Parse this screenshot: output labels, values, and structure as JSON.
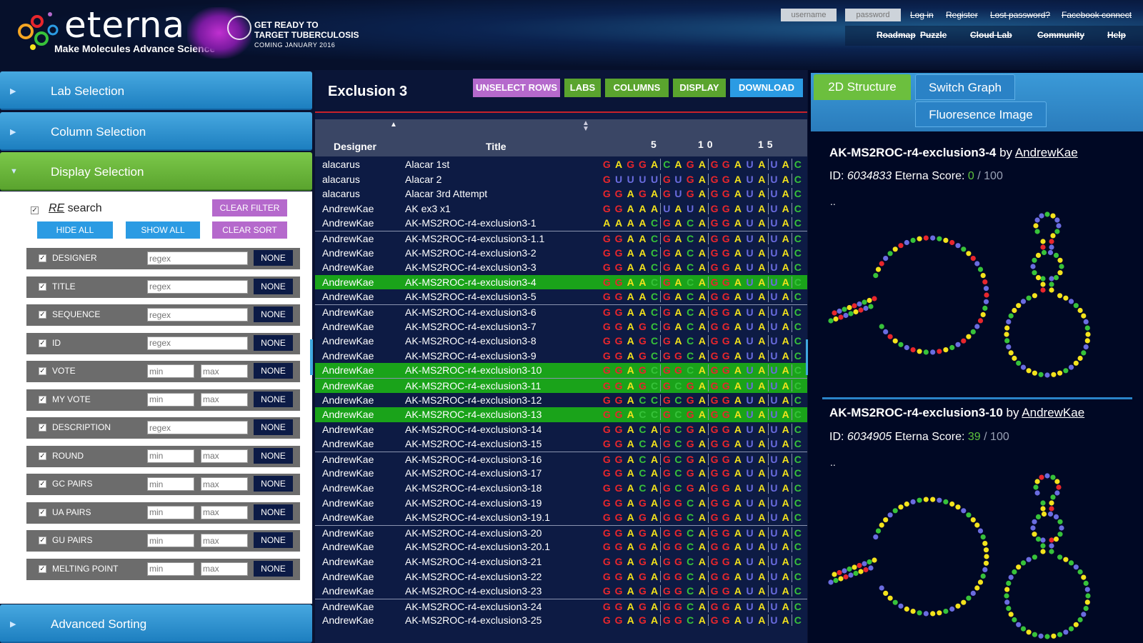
{
  "header": {
    "brand": "eterna",
    "tagline": "Make Molecules  Advance Science",
    "promo_line1": "GET READY TO",
    "promo_line2": "TARGET TUBERCULOSIS",
    "promo_line3": "COMING JANUARY 2016",
    "username_placeholder": "username",
    "password_placeholder": "password",
    "links": [
      "Log in",
      "Register",
      "Lost password?",
      "Facebook connect"
    ],
    "nav": [
      "Roadmap",
      "Puzzle",
      "Cloud Lab",
      "Community",
      "Help"
    ]
  },
  "sidebar": {
    "lab_selection": "Lab Selection",
    "column_selection": "Column Selection",
    "display_selection": "Display Selection",
    "advanced_sorting": "Advanced Sorting",
    "re_prefix": "RE",
    "re_search": " search",
    "clear_filter": "CLEAR FILTER",
    "hide_all": "HIDE ALL",
    "show_all": "SHOW ALL",
    "clear_sort": "CLEAR SORT",
    "none_label": "NONE",
    "filters": [
      {
        "name": "DESIGNER",
        "kind": "regex",
        "p1": "regex"
      },
      {
        "name": "TITLE",
        "kind": "regex",
        "p1": "regex"
      },
      {
        "name": "SEQUENCE",
        "kind": "regex",
        "p1": "regex"
      },
      {
        "name": "ID",
        "kind": "regex",
        "p1": "regex"
      },
      {
        "name": "VOTE",
        "kind": "range",
        "p1": "min",
        "p2": "max"
      },
      {
        "name": "MY VOTE",
        "kind": "range",
        "p1": "min",
        "p2": "max"
      },
      {
        "name": "DESCRIPTION",
        "kind": "regex",
        "p1": "regex"
      },
      {
        "name": "ROUND",
        "kind": "range",
        "p1": "min",
        "p2": "max"
      },
      {
        "name": "GC PAIRS",
        "kind": "range",
        "p1": "min",
        "p2": "max"
      },
      {
        "name": "UA PAIRS",
        "kind": "range",
        "p1": "min",
        "p2": "max"
      },
      {
        "name": "GU PAIRS",
        "kind": "range",
        "p1": "min",
        "p2": "max"
      },
      {
        "name": "MELTING POINT",
        "kind": "range",
        "p1": "min",
        "p2": "max"
      }
    ]
  },
  "table": {
    "title": "Exclusion 3",
    "buttons": [
      "UNSELECT ROWS",
      "LABS",
      "COLUMNS",
      "DISPLAY",
      "DOWNLOAD"
    ],
    "col_designer": "Designer",
    "col_title": "Title",
    "seq_ticks": [
      "5",
      "10",
      "15"
    ],
    "rows": [
      {
        "designer": "alacarus",
        "title": "Alacar 1st",
        "seq": "GAGGACAGAGGAUAUAC",
        "sel": false,
        "grp": true
      },
      {
        "designer": "alacarus",
        "title": "Alacar 2",
        "seq": "GUUUUGUGAGGAUAUAC",
        "sel": false,
        "grp": false
      },
      {
        "designer": "alacarus",
        "title": "Alacar 3rd Attempt",
        "seq": "GGAGAGUGAGGAUAUAC",
        "sel": false,
        "grp": false
      },
      {
        "designer": "AndrewKae",
        "title": "AK ex3 x1",
        "seq": "GGAAAUAUAGGAUAUAC",
        "sel": false,
        "grp": false
      },
      {
        "designer": "AndrewKae",
        "title": "AK-MS2ROC-r4-exclusion3-1",
        "seq": "AAAACGACAGGAUAUAC",
        "sel": false,
        "grp": false
      },
      {
        "designer": "AndrewKae",
        "title": "AK-MS2ROC-r4-exclusion3-1.1",
        "seq": "GGAACGACAGGAUAUAC",
        "sel": false,
        "grp": true
      },
      {
        "designer": "AndrewKae",
        "title": "AK-MS2ROC-r4-exclusion3-2",
        "seq": "GGAACGACAGGAUAUAC",
        "sel": false,
        "grp": false
      },
      {
        "designer": "AndrewKae",
        "title": "AK-MS2ROC-r4-exclusion3-3",
        "seq": "GGAACGACAGGAUAUAC",
        "sel": false,
        "grp": false
      },
      {
        "designer": "AndrewKae",
        "title": "AK-MS2ROC-r4-exclusion3-4",
        "seq": "GGAACGACAGGAUAUAC",
        "sel": true,
        "grp": false
      },
      {
        "designer": "AndrewKae",
        "title": "AK-MS2ROC-r4-exclusion3-5",
        "seq": "GGAACGACAGGAUAUAC",
        "sel": false,
        "grp": false
      },
      {
        "designer": "AndrewKae",
        "title": "AK-MS2ROC-r4-exclusion3-6",
        "seq": "GGAACGACAGGAUAUAC",
        "sel": false,
        "grp": true
      },
      {
        "designer": "AndrewKae",
        "title": "AK-MS2ROC-r4-exclusion3-7",
        "seq": "GGAGCGACAGGAUAUAC",
        "sel": false,
        "grp": false
      },
      {
        "designer": "AndrewKae",
        "title": "AK-MS2ROC-r4-exclusion3-8",
        "seq": "GGAGCGACAGGAUAUAC",
        "sel": false,
        "grp": false
      },
      {
        "designer": "AndrewKae",
        "title": "AK-MS2ROC-r4-exclusion3-9",
        "seq": "GGAGCGGCAGGAUAUAC",
        "sel": false,
        "grp": false
      },
      {
        "designer": "AndrewKae",
        "title": "AK-MS2ROC-r4-exclusion3-10",
        "seq": "GGAGCGGCAGGAUAUAC",
        "sel": true,
        "grp": false
      },
      {
        "designer": "AndrewKae",
        "title": "AK-MS2ROC-r4-exclusion3-11",
        "seq": "GGAGCGCGAGGAUAUAC",
        "sel": true,
        "grp": true
      },
      {
        "designer": "AndrewKae",
        "title": "AK-MS2ROC-r4-exclusion3-12",
        "seq": "GGACCGCGAGGAUAUAC",
        "sel": false,
        "grp": false
      },
      {
        "designer": "AndrewKae",
        "title": "AK-MS2ROC-r4-exclusion3-13",
        "seq": "GGACCGCGAGGAUAUAC",
        "sel": true,
        "grp": false
      },
      {
        "designer": "AndrewKae",
        "title": "AK-MS2ROC-r4-exclusion3-14",
        "seq": "GGACAGCGAGGAUAUAC",
        "sel": false,
        "grp": false
      },
      {
        "designer": "AndrewKae",
        "title": "AK-MS2ROC-r4-exclusion3-15",
        "seq": "GGACAGCGAGGAUAUAC",
        "sel": false,
        "grp": false
      },
      {
        "designer": "AndrewKae",
        "title": "AK-MS2ROC-r4-exclusion3-16",
        "seq": "GGACAGCGAGGAUAUAC",
        "sel": false,
        "grp": true
      },
      {
        "designer": "AndrewKae",
        "title": "AK-MS2ROC-r4-exclusion3-17",
        "seq": "GGACAGCGAGGAUAUAC",
        "sel": false,
        "grp": false
      },
      {
        "designer": "AndrewKae",
        "title": "AK-MS2ROC-r4-exclusion3-18",
        "seq": "GGACAGCGAGGAUAUAC",
        "sel": false,
        "grp": false
      },
      {
        "designer": "AndrewKae",
        "title": "AK-MS2ROC-r4-exclusion3-19",
        "seq": "GGAGAGGCAGGAUAUAC",
        "sel": false,
        "grp": false
      },
      {
        "designer": "AndrewKae",
        "title": "AK-MS2ROC-r4-exclusion3-19.1",
        "seq": "GGAGAGGCAGGAUAUAC",
        "sel": false,
        "grp": false
      },
      {
        "designer": "AndrewKae",
        "title": "AK-MS2ROC-r4-exclusion3-20",
        "seq": "GGAGAGGCAGGAUAUAC",
        "sel": false,
        "grp": true
      },
      {
        "designer": "AndrewKae",
        "title": "AK-MS2ROC-r4-exclusion3-20.1",
        "seq": "GGAGAGGCAGGAUAUAC",
        "sel": false,
        "grp": false
      },
      {
        "designer": "AndrewKae",
        "title": "AK-MS2ROC-r4-exclusion3-21",
        "seq": "GGAGAGGCAGGAUAUAC",
        "sel": false,
        "grp": false
      },
      {
        "designer": "AndrewKae",
        "title": "AK-MS2ROC-r4-exclusion3-22",
        "seq": "GGAGAGGCAGGAUAUAC",
        "sel": false,
        "grp": false
      },
      {
        "designer": "AndrewKae",
        "title": "AK-MS2ROC-r4-exclusion3-23",
        "seq": "GGAGAGGCAGGAUAUAC",
        "sel": false,
        "grp": false
      },
      {
        "designer": "AndrewKae",
        "title": "AK-MS2ROC-r4-exclusion3-24",
        "seq": "GGAGAGGCAGGAUAUAC",
        "sel": false,
        "grp": true
      },
      {
        "designer": "AndrewKae",
        "title": "AK-MS2ROC-r4-exclusion3-25",
        "seq": "GGAGAGGCAGGAUAUAC",
        "sel": false,
        "grp": false
      }
    ]
  },
  "right": {
    "tab_2d": "2D Structure",
    "tab_switch": "Switch Graph",
    "tab_fluor": "Fluoresence Image",
    "cards": [
      {
        "title": "AK-MS2ROC-r4-exclusion3-4",
        "by": "by",
        "author": "AndrewKae",
        "id_label": "ID: ",
        "id": "6034833",
        "score_label": " Eterna Score: ",
        "score": "0",
        "score_max": " / 100",
        "dots": ".."
      },
      {
        "title": "AK-MS2ROC-r4-exclusion3-10",
        "by": "by",
        "author": "AndrewKae",
        "id_label": "ID: ",
        "id": "6034905",
        "score_label": " Eterna Score: ",
        "score": "39",
        "score_max": " / 100",
        "dots": ".."
      }
    ]
  },
  "colors": {
    "G": "#e8262c",
    "A": "#f4e31c",
    "C": "#37c23a",
    "U": "#6a6ce0",
    "accent_blue": "#2b9be3",
    "accent_green": "#5aa42e",
    "accent_purple": "#b569cc"
  }
}
